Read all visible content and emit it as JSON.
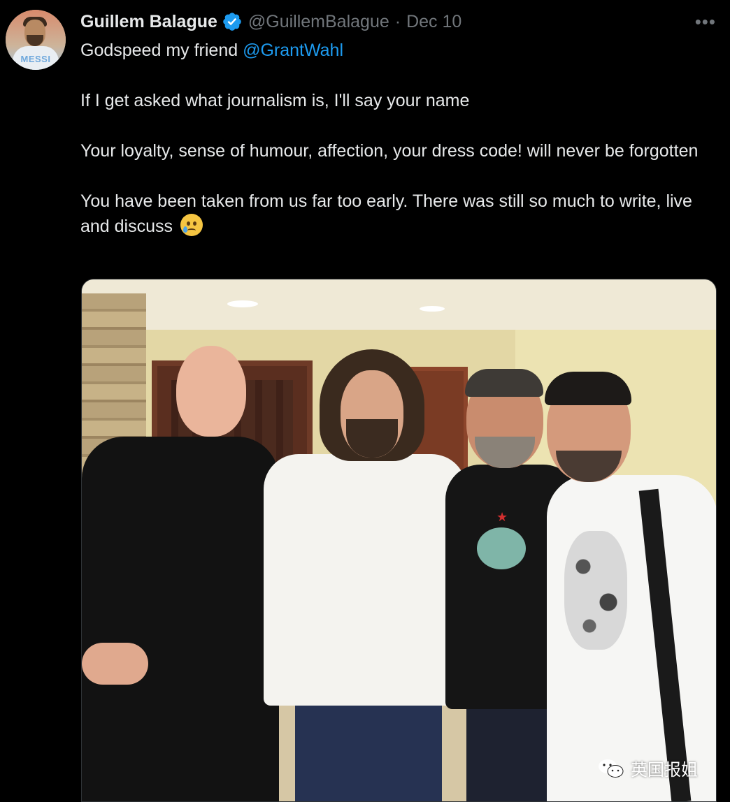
{
  "tweet": {
    "author_name": "Guillem Balague",
    "handle": "@GuillemBalague",
    "separator": "·",
    "date": "Dec 10",
    "avatar_text": "MESSI",
    "more_label": "•••",
    "text": {
      "line1_prefix": "Godspeed my friend ",
      "line1_mention": "@GrantWahl",
      "para2": "If I get asked what journalism is, I'll say your name",
      "para3": "Your loyalty, sense of humour, affection, your dress code! will never be forgotten",
      "para4": "You have been taken from us far too early. There was still so much to write, live and discuss"
    },
    "emoji": "sad-but-relieved-face"
  },
  "watermark": {
    "text": "英国报姐"
  },
  "colors": {
    "background": "#000000",
    "text": "#e7e9ea",
    "muted": "#71767b",
    "link": "#1d9bf0",
    "verified": "#1d9bf0"
  }
}
